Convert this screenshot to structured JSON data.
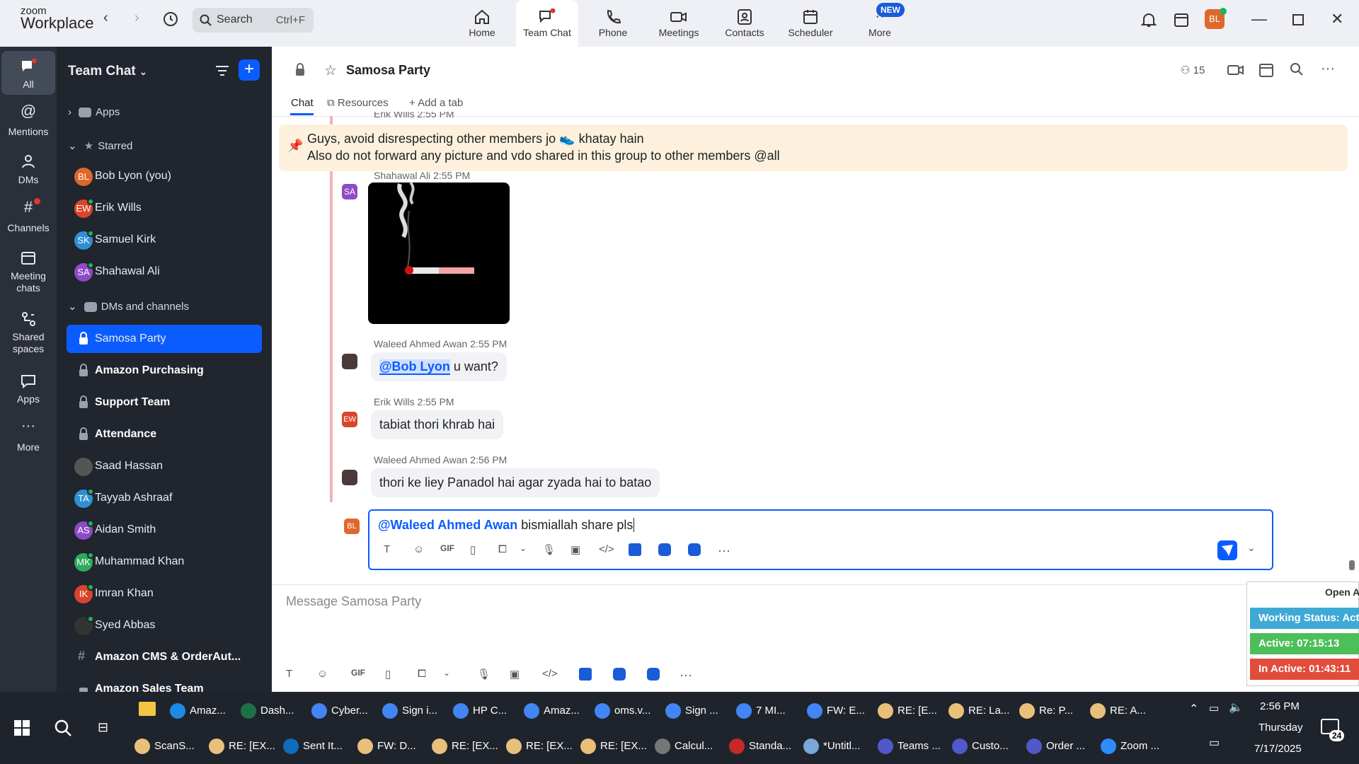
{
  "app": {
    "brand_small": "zoom",
    "brand_big": "Workplace",
    "search_label": "Search",
    "search_shortcut": "Ctrl+F"
  },
  "tabs": [
    {
      "label": "Home"
    },
    {
      "label": "Team Chat"
    },
    {
      "label": "Phone"
    },
    {
      "label": "Meetings"
    },
    {
      "label": "Contacts"
    },
    {
      "label": "Scheduler"
    },
    {
      "label": "More"
    }
  ],
  "new_badge": "NEW",
  "user_avatar": "BL",
  "rail": [
    {
      "label": "All"
    },
    {
      "label": "Mentions"
    },
    {
      "label": "DMs"
    },
    {
      "label": "Channels"
    },
    {
      "label": "Meeting chats"
    },
    {
      "label": "Shared spaces"
    },
    {
      "label": "Apps"
    },
    {
      "label": "More"
    }
  ],
  "sidebar": {
    "title": "Team Chat",
    "sections": {
      "apps": "Apps",
      "starred": "Starred",
      "dms": "DMs and channels"
    },
    "starred": [
      {
        "initials": "BL",
        "name": "Bob Lyon (you)",
        "color": "#e0672c"
      },
      {
        "initials": "EW",
        "name": "Erik Wills",
        "color": "#d9452b"
      },
      {
        "initials": "SK",
        "name": "Samuel Kirk",
        "color": "#2f8fd4"
      },
      {
        "initials": "SA",
        "name": "Shahawal Ali",
        "color": "#8d4bc5"
      }
    ],
    "channels": [
      {
        "initials": "",
        "name": "Samosa Party",
        "type": "lock"
      },
      {
        "initials": "",
        "name": "Amazon Purchasing",
        "type": "lock"
      },
      {
        "initials": "",
        "name": "Support Team",
        "type": "lock"
      },
      {
        "initials": "",
        "name": "Attendance",
        "type": "lock"
      },
      {
        "initials": "",
        "name": "Saad Hassan",
        "type": "photo",
        "color": "#444"
      },
      {
        "initials": "TA",
        "name": "Tayyab Ashraaf",
        "type": "av",
        "color": "#2f8fd4"
      },
      {
        "initials": "AS",
        "name": "Aidan Smith",
        "type": "av",
        "color": "#8d4bc5"
      },
      {
        "initials": "MK",
        "name": "Muhammad Khan",
        "type": "av",
        "color": "#2eaa5b"
      },
      {
        "initials": "IK",
        "name": "Imran Khan",
        "type": "av",
        "color": "#d9452b"
      },
      {
        "initials": "",
        "name": "Syed Abbas",
        "type": "photo",
        "color": "#333"
      },
      {
        "initials": "",
        "name": "Amazon CMS & OrderAut...",
        "type": "hash"
      },
      {
        "initials": "",
        "name": "Amazon Sales Team",
        "type": "lock"
      }
    ]
  },
  "channel": {
    "title": "Samosa Party",
    "member_count": "15",
    "tabs": {
      "chat": "Chat",
      "resources": "Resources",
      "add": "Add a tab"
    }
  },
  "pinned": {
    "line1": "Guys, avoid disrespecting other members jo 👟 khatay hain",
    "line2": "Also do not forward any picture and vdo shared in this group to other members @all",
    "partial_meta": "Erik Wills 2:55 PM"
  },
  "messages": [
    {
      "sender": "Shahawal Ali",
      "time": "2:55 PM",
      "initials": "SA",
      "color": "#8d4bc5"
    },
    {
      "sender": "Waleed Ahmed Awan",
      "time": "2:55 PM",
      "mention": "@Bob Lyon",
      "text": " u want?"
    },
    {
      "sender": "Erik Wills",
      "time": "2:55 PM",
      "initials": "EW",
      "color": "#d9452b",
      "text": "tabiat thori khrab hai"
    },
    {
      "sender": "Waleed Ahmed Awan",
      "time": "2:56 PM",
      "text": "thori ke liey Panadol hai agar zyada hai to batao"
    }
  ],
  "reply": {
    "initials": "BL",
    "mention": "@Waleed Ahmed Awan",
    "text": " bismiallah share pls"
  },
  "composer": {
    "placeholder": "Message Samosa Party",
    "gif": "GIF"
  },
  "floating": {
    "header": "Open A",
    "status": "Working Status: Acti",
    "active": "Active: 07:15:13",
    "inactive": "In Active: 01:43:11"
  },
  "taskbar": {
    "row1": [
      "Amaz...",
      "Dash...",
      "Cyber...",
      "Sign i...",
      "HP C...",
      "Amaz...",
      "oms.v...",
      "Sign ...",
      "7 MI...",
      "FW: E...",
      "RE: [E...",
      "RE: La...",
      "Re: P...",
      "RE: A..."
    ],
    "row2": [
      "ScanS...",
      "RE: [EX...",
      "Sent It...",
      "FW: D...",
      "RE: [EX...",
      "RE: [EX...",
      "RE: [EX...",
      "Calcul...",
      "Standa...",
      "*Untitl...",
      "Teams ...",
      "Custo...",
      "Order ...",
      "Zoom ..."
    ],
    "time": "2:56 PM",
    "day": "Thursday",
    "date": "7/17/2025",
    "notif": "24"
  }
}
